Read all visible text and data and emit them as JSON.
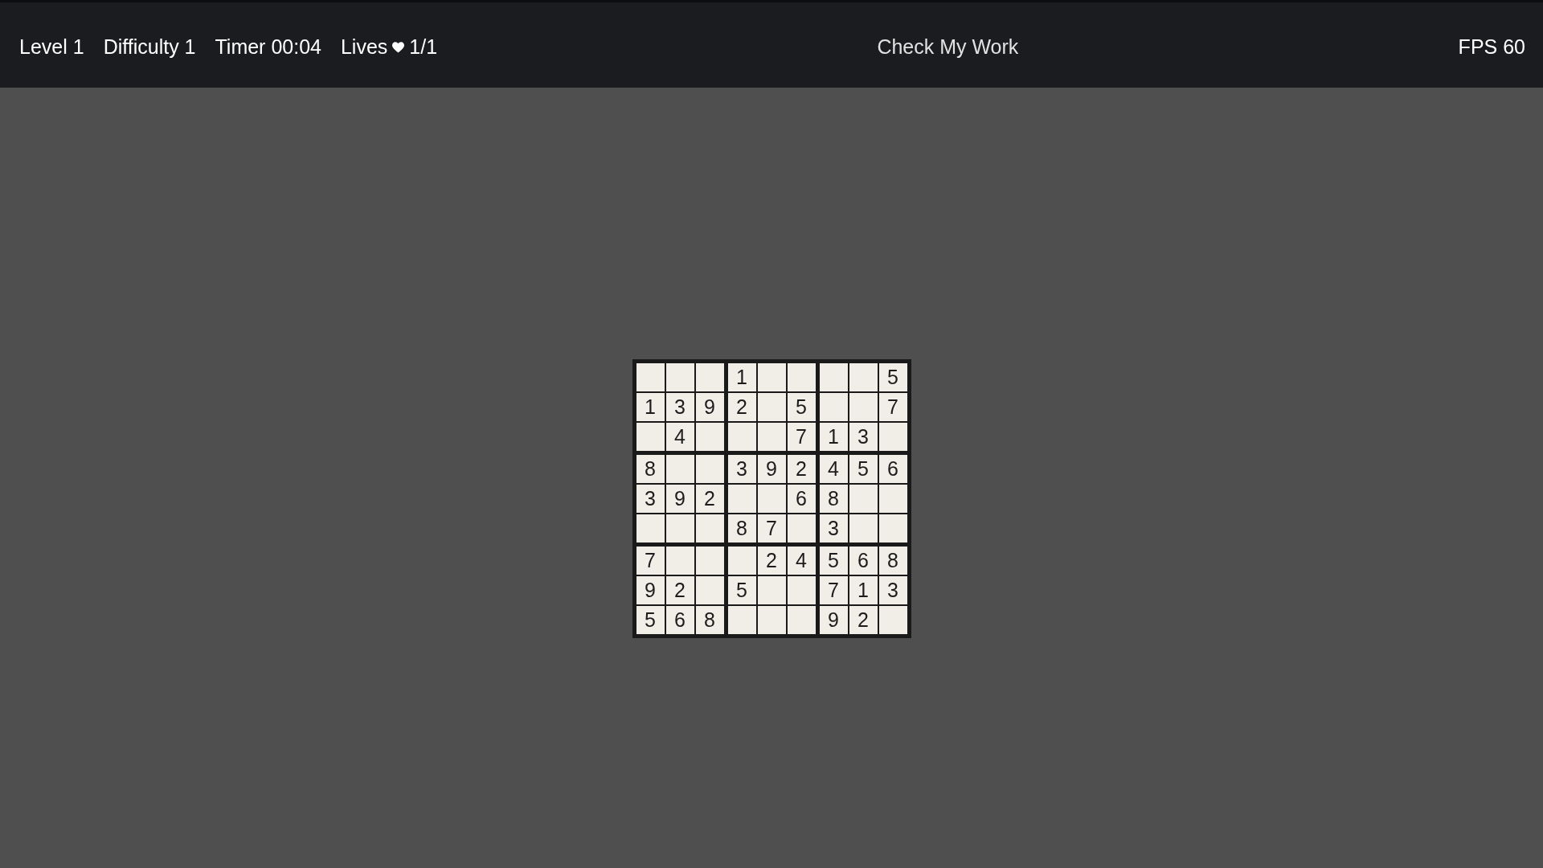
{
  "top_bar": {
    "level": "Level 1",
    "difficulty": "Difficulty 1",
    "timer": "Timer 00:04",
    "lives": {
      "label": "Lives",
      "count": "1/1"
    },
    "check_button": "Check My Work",
    "fps": "FPS 60"
  },
  "board": {
    "rows": [
      [
        null,
        null,
        null,
        "1",
        null,
        null,
        null,
        null,
        "5"
      ],
      [
        "1",
        "3",
        "9",
        "2",
        null,
        "5",
        null,
        null,
        "7"
      ],
      [
        null,
        "4",
        null,
        null,
        null,
        "7",
        "1",
        "3",
        null
      ],
      [
        "8",
        null,
        null,
        "3",
        "9",
        "2",
        "4",
        "5",
        "6"
      ],
      [
        "3",
        "9",
        "2",
        null,
        null,
        "6",
        "8",
        null,
        null
      ],
      [
        null,
        null,
        null,
        "8",
        "7",
        null,
        "3",
        null,
        null
      ],
      [
        "7",
        null,
        null,
        null,
        "2",
        "4",
        "5",
        "6",
        "8"
      ],
      [
        "9",
        "2",
        null,
        "5",
        null,
        null,
        "7",
        "1",
        "3"
      ],
      [
        "5",
        "6",
        "8",
        null,
        null,
        null,
        "9",
        "2",
        null
      ]
    ]
  }
}
